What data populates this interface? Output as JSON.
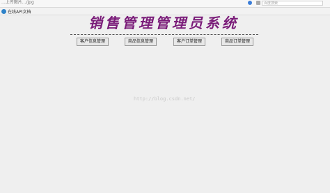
{
  "browser": {
    "address": "...上传图片.../jpg",
    "search_placeholder": "百度搜索"
  },
  "bookmarks": [
    {
      "label": "在线API文档"
    }
  ],
  "page": {
    "title": "销售管理管理员系统"
  },
  "nav": [
    {
      "label": "客户信息管理"
    },
    {
      "label": "商品信息管理"
    },
    {
      "label": "客户订单管理"
    },
    {
      "label": "商品订单管理"
    }
  ],
  "watermark": "http://blog.csdn.net/"
}
